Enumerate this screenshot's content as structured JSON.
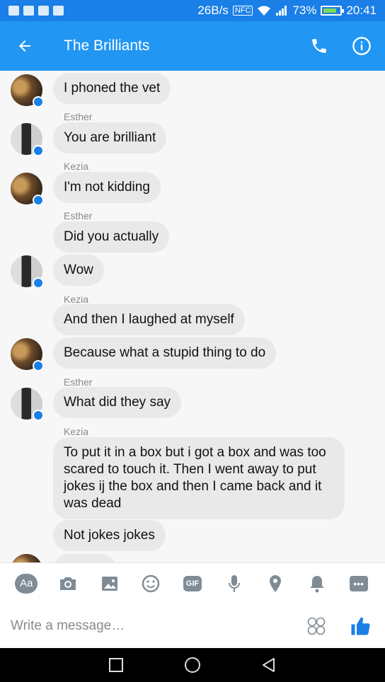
{
  "status_bar": {
    "network": "26B/s",
    "nfc": "NFC",
    "battery_pct": "73%",
    "time": "20:41"
  },
  "header": {
    "title": "The Brilliants"
  },
  "messages": [
    {
      "sender": "",
      "text": "I phoned the vet"
    },
    {
      "sender": "Esther",
      "text": "You are brilliant"
    },
    {
      "sender": "Kezia",
      "text": "I'm not kidding"
    },
    {
      "sender": "Esther",
      "text": "Did you actually"
    },
    {
      "sender": "",
      "text": "Wow"
    },
    {
      "sender": "Kezia",
      "text": "And then I laughed at myself"
    },
    {
      "sender": "",
      "text": "Because what a stupid thing to do"
    },
    {
      "sender": "Esther",
      "text": "What did they say"
    },
    {
      "sender": "Kezia",
      "text": "To put it in a box but i got a box and was too scared to touch it. Then I went away to put jokes ij the box and then I came back and it was dead"
    },
    {
      "sender": "",
      "text": "Not jokes jokes"
    }
  ],
  "toolbar": {
    "aa_label": "Aa",
    "gif_label": "GIF"
  },
  "composer": {
    "placeholder": "Write a message…"
  },
  "colors": {
    "header": "#2196f3",
    "status": "#1a7fe6",
    "bubble": "#e9e9ea",
    "icon": "#7f8c96",
    "like": "#1a7fe6"
  }
}
